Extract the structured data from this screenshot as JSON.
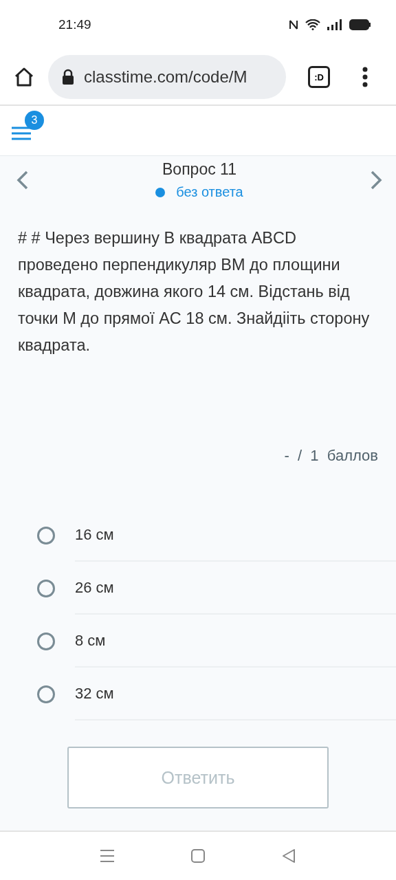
{
  "status_bar": {
    "time": "21:49"
  },
  "browser": {
    "url": "classtime.com/code/M",
    "tab_label": ":D"
  },
  "header": {
    "badge": "3"
  },
  "question": {
    "title": "Вопрос 11",
    "status": "без ответа",
    "text": "# # Через вершину B квадрата ABCD проведено перпендикуляр BM до площини квадрата, довжина якого 14 см. Відстань від точки M до прямої AC 18 см. Знайдііть сторону квадрата.",
    "score": "-  /  1  баллов"
  },
  "options": [
    {
      "label": "16 см",
      "selected": false
    },
    {
      "label": "26 см",
      "selected": false
    },
    {
      "label": "8 см",
      "selected": false
    },
    {
      "label": "32 см",
      "selected": false
    }
  ],
  "submit": {
    "label": "Ответить",
    "disabled": true
  }
}
